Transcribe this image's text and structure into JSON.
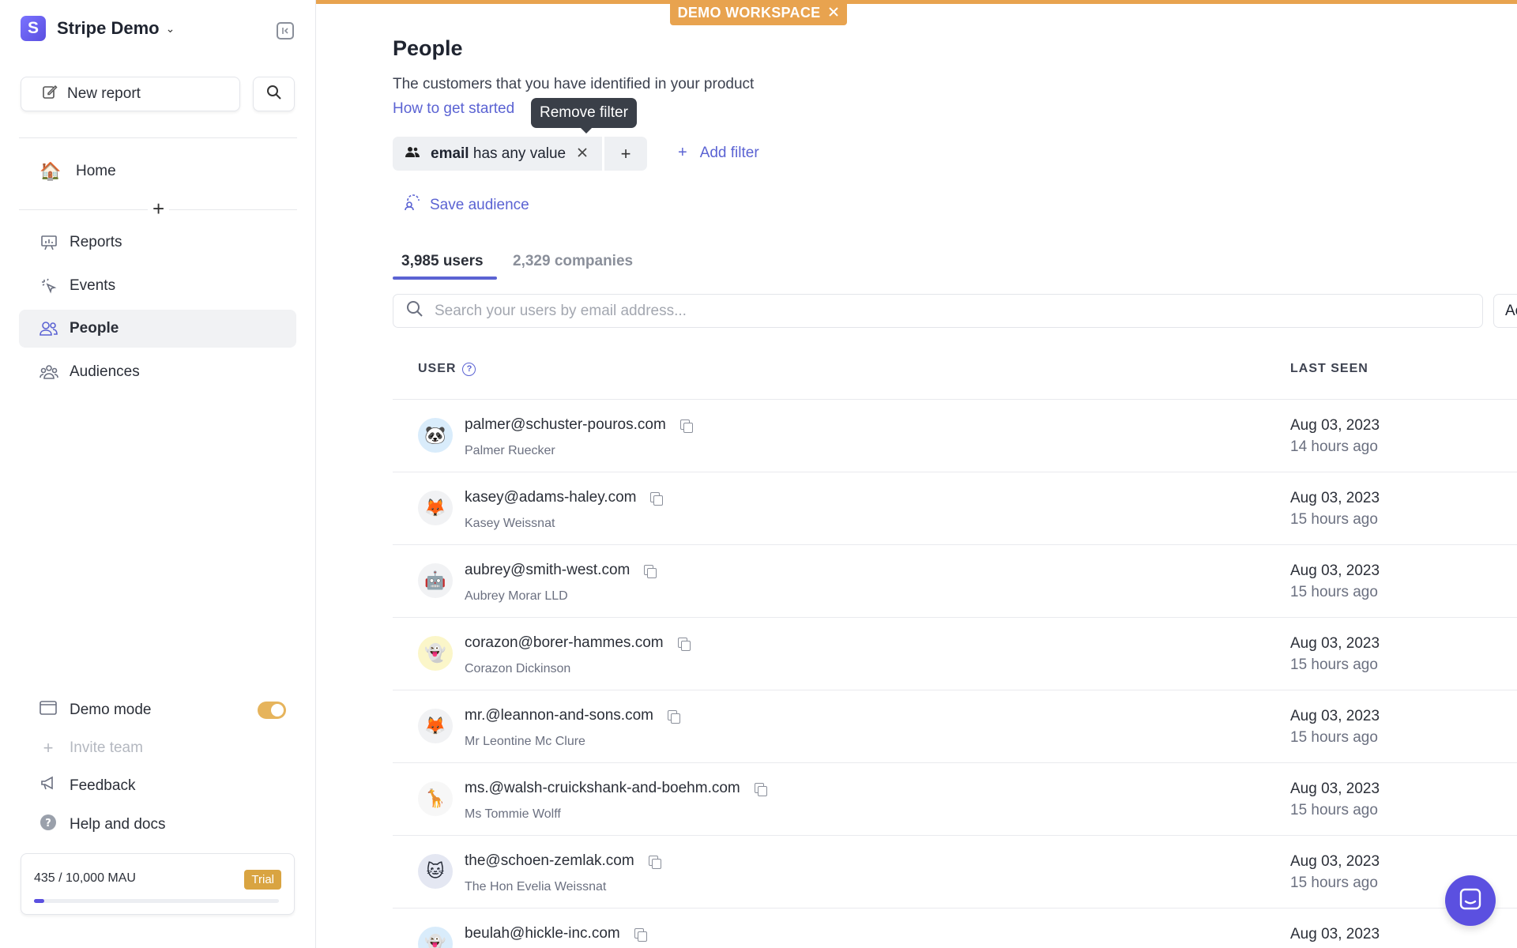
{
  "workspace": {
    "initial": "S",
    "name": "Stripe Demo"
  },
  "sidebar": {
    "new_report": "New report",
    "home": "Home",
    "items": [
      {
        "label": "Reports"
      },
      {
        "label": "Events"
      },
      {
        "label": "People"
      },
      {
        "label": "Audiences"
      }
    ],
    "bottom": {
      "demo_mode": "Demo mode",
      "invite_team": "Invite team",
      "feedback": "Feedback",
      "help": "Help and docs"
    },
    "mau": {
      "text": "435 / 10,000 MAU",
      "badge": "Trial",
      "progress": 0.0435
    }
  },
  "banner": {
    "label": "DEMO WORKSPACE"
  },
  "main": {
    "title": "People",
    "subtitle": "The customers that you have identified in your product",
    "link": "How to get started",
    "tooltip": "Remove filter",
    "filter": {
      "field": "email",
      "condition": "has any value"
    },
    "add_filter": "Add filter",
    "save_audience": "Save audience",
    "tabs": [
      {
        "label": "3,985 users"
      },
      {
        "label": "2,329 companies"
      }
    ],
    "search_placeholder": "Search your users by email address...",
    "extra_button": "Ac",
    "columns": {
      "user": "USER",
      "last_seen": "LAST SEEN"
    },
    "rows": [
      {
        "email": "palmer@schuster-pouros.com",
        "name": "Palmer Ruecker",
        "date": "Aug 03, 2023",
        "ago": "14 hours ago",
        "avatar": "🐼",
        "bg": "#d9ecfb"
      },
      {
        "email": "kasey@adams-haley.com",
        "name": "Kasey Weissnat",
        "date": "Aug 03, 2023",
        "ago": "15 hours ago",
        "avatar": "🦊",
        "bg": "#f1f2f4"
      },
      {
        "email": "aubrey@smith-west.com",
        "name": "Aubrey Morar LLD",
        "date": "Aug 03, 2023",
        "ago": "15 hours ago",
        "avatar": "🤖",
        "bg": "#f1f2f4"
      },
      {
        "email": "corazon@borer-hammes.com",
        "name": "Corazon Dickinson",
        "date": "Aug 03, 2023",
        "ago": "15 hours ago",
        "avatar": "👻",
        "bg": "#fbf6c9"
      },
      {
        "email": "mr.@leannon-and-sons.com",
        "name": "Mr Leontine Mc Clure",
        "date": "Aug 03, 2023",
        "ago": "15 hours ago",
        "avatar": "🦊",
        "bg": "#f1f2f4"
      },
      {
        "email": "ms.@walsh-cruickshank-and-boehm.com",
        "name": "Ms Tommie Wolff",
        "date": "Aug 03, 2023",
        "ago": "15 hours ago",
        "avatar": "🦒",
        "bg": "#f7f7f7"
      },
      {
        "email": "the@schoen-zemlak.com",
        "name": "The Hon Evelia Weissnat",
        "date": "Aug 03, 2023",
        "ago": "15 hours ago",
        "avatar": "🐱",
        "bg": "#e4e7f2"
      },
      {
        "email": "beulah@hickle-inc.com",
        "name": "",
        "date": "Aug 03, 2023",
        "ago": "",
        "avatar": "👻",
        "bg": "#d9ecfb"
      }
    ]
  },
  "colors": {
    "accent": "#5b63d3",
    "banner": "#e8a34f",
    "brand": "#5b50e0"
  }
}
